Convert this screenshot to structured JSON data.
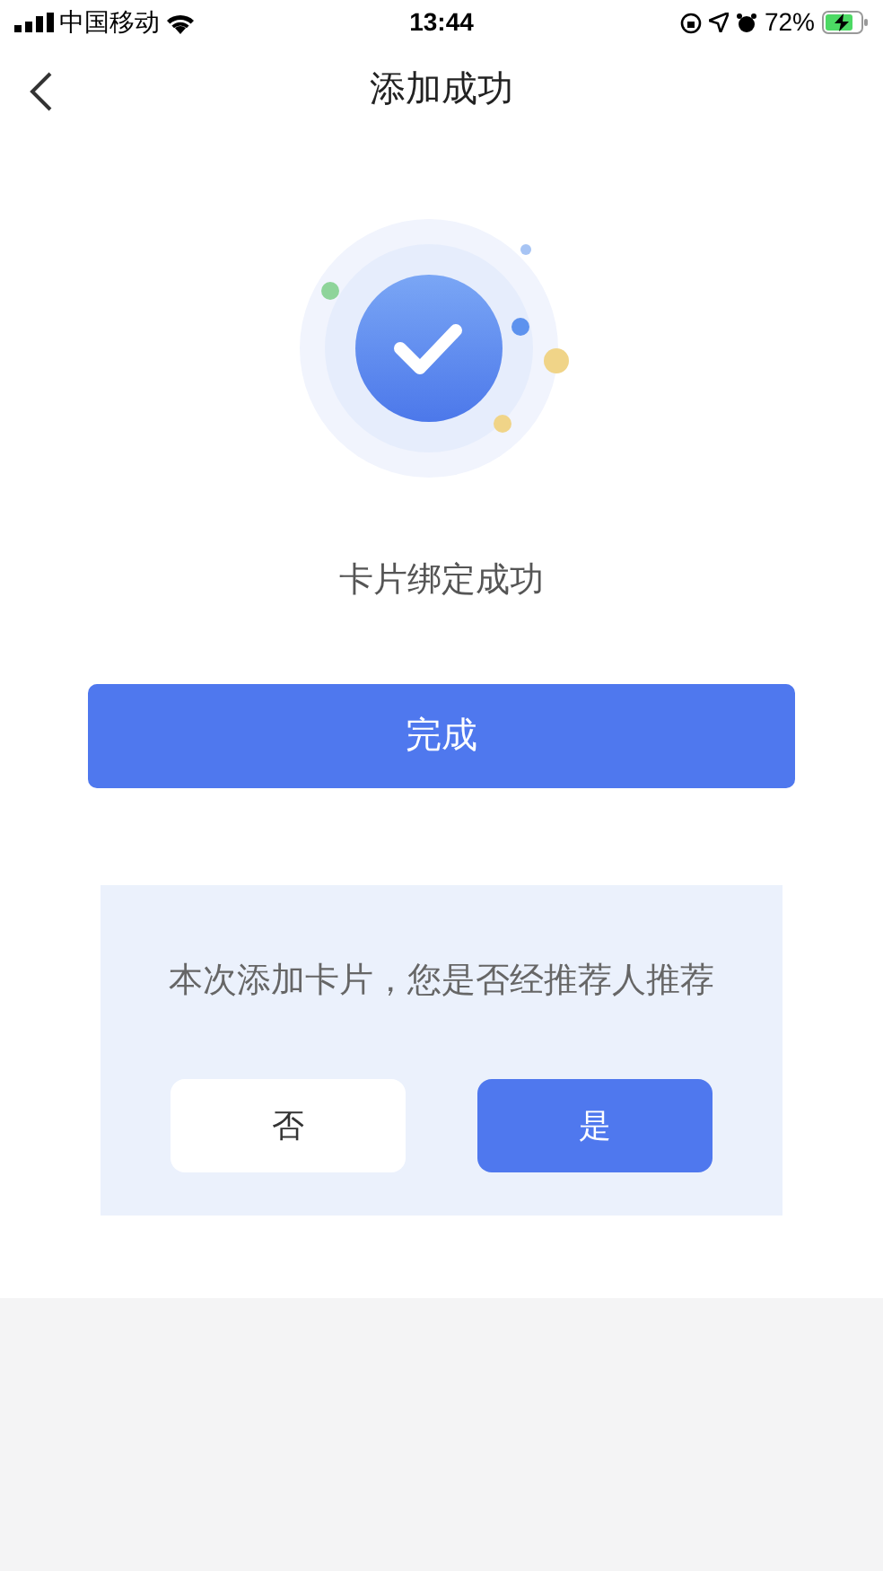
{
  "status_bar": {
    "carrier": "中国移动",
    "time": "13:44",
    "battery": "72%"
  },
  "nav": {
    "title": "添加成功"
  },
  "message": "卡片绑定成功",
  "done_button": "完成",
  "referral": {
    "question": "本次添加卡片，您是否经推荐人推荐",
    "options": [
      {
        "label": "否",
        "kind": "secondary"
      },
      {
        "label": "是",
        "kind": "primary"
      }
    ]
  }
}
